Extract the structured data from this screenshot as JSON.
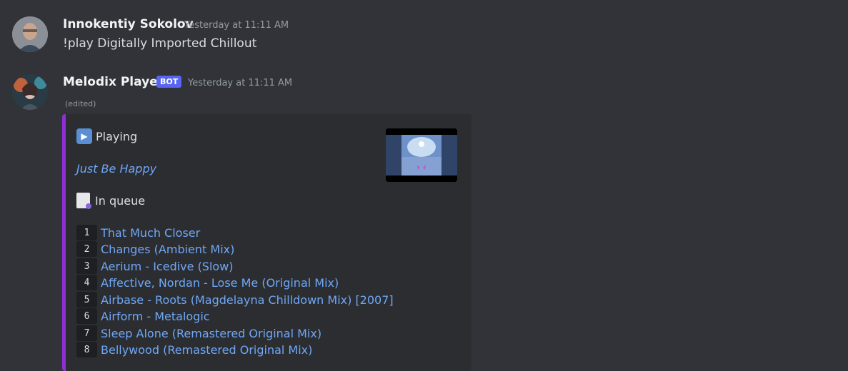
{
  "messages": [
    {
      "author": "Innokentiy Sokolov",
      "timestamp": "Yesterday at 11:11 AM",
      "content": "!play Digitally Imported Chillout"
    },
    {
      "author": "Melodix Player",
      "badge": "BOT",
      "timestamp": "Yesterday at 11:11 AM",
      "edited": "(edited)"
    }
  ],
  "embed": {
    "accent_color": "#8e2fd6",
    "playing_icon": "play-button-emoji",
    "playing_label": "Playing",
    "now_playing": "Just Be Happy",
    "queue_icon": "page-facing-up-emoji",
    "queue_label": "In queue",
    "queue": [
      {
        "num": "1",
        "title": "That Much Closer"
      },
      {
        "num": "2",
        "title": "Changes (Ambient Mix)"
      },
      {
        "num": "3",
        "title": "Aerium - Icedive (Slow)"
      },
      {
        "num": "4",
        "title": "Affective, Nordan - Lose Me (Original Mix)"
      },
      {
        "num": "5",
        "title": "Airbase - Roots (Magdelayna Chilldown Mix) [2007]"
      },
      {
        "num": "6",
        "title": "Airform - Metalogic"
      },
      {
        "num": "7",
        "title": "Sleep Alone (Remastered Original Mix)"
      },
      {
        "num": "8",
        "title": "Bellywood (Remastered Original Mix)"
      }
    ]
  },
  "colors": {
    "background": "#313338",
    "embed_bg": "#2b2d31",
    "link": "#6fa8f7",
    "bot_badge": "#5865f2"
  }
}
